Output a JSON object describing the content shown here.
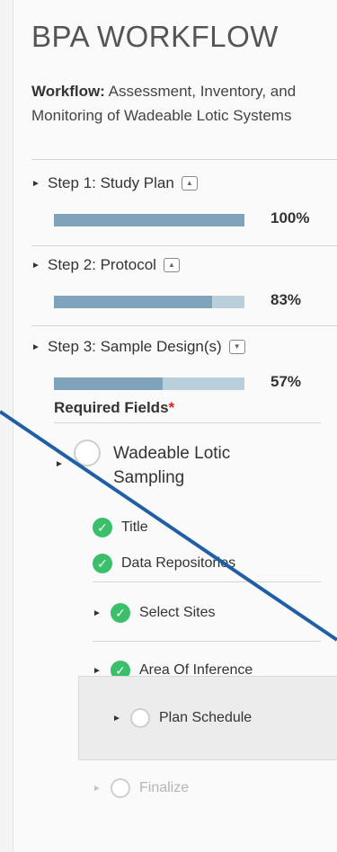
{
  "header": {
    "title": "BPA WORKFLOW"
  },
  "workflow": {
    "label": "Workflow:",
    "name": "Assessment, Inventory, and Monitoring of Wadeable Lotic Systems"
  },
  "steps": [
    {
      "label": "Step 1: Study Plan",
      "percent_text": "100%",
      "progress": 1.0,
      "expanded": false
    },
    {
      "label": "Step 2: Protocol",
      "percent_text": "83%",
      "progress": 0.83,
      "expanded": false
    },
    {
      "label": "Step 3: Sample Design(s)",
      "percent_text": "57%",
      "progress": 0.57,
      "expanded": true
    }
  ],
  "required": {
    "label": "Required Fields",
    "star": "*"
  },
  "sampling": {
    "label": "Wadeable Lotic Sampling",
    "items": [
      {
        "label": "Title",
        "status": "complete"
      },
      {
        "label": "Data Repositories",
        "status": "complete"
      }
    ],
    "subsections": [
      {
        "label": "Select Sites",
        "status": "complete"
      },
      {
        "label": "Area Of Inference",
        "status": "complete"
      },
      {
        "label": "Plan Schedule",
        "status": "incomplete"
      },
      {
        "label": "Finalize",
        "status": "disabled"
      }
    ]
  },
  "colors": {
    "progress_fill": "#7fa3bb",
    "progress_track": "#b9cfdc",
    "check_green": "#3bbf6b",
    "required_star": "#dd2222",
    "overlay_line": "#1f5fa6"
  }
}
